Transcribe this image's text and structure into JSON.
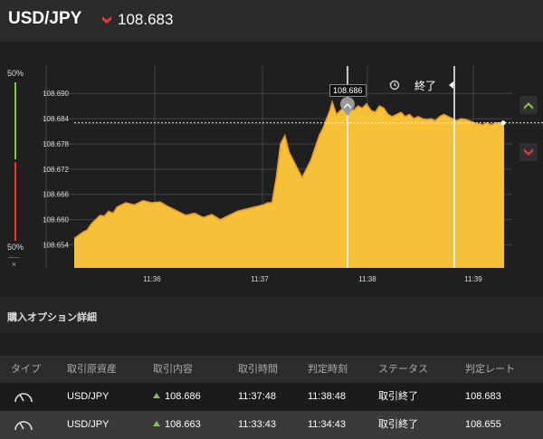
{
  "header": {
    "pair": "USD/JPY",
    "rate": "108.683",
    "direction_icon": "down-chevron-icon",
    "direction_color": "#e53935"
  },
  "chart": {
    "left_gauge": {
      "top_pct": "50%",
      "bottom_pct": "50%",
      "up_color": "#8bc34a",
      "down_color": "#e53935",
      "close_label": "×"
    },
    "tooltip_rate": "108.686",
    "end_label": "終了",
    "buttons": {
      "up_icon": "up-chevron-icon",
      "down_icon": "down-chevron-icon"
    },
    "colors": {
      "area_fill": "#f7c137",
      "area_stroke": "#e5932a",
      "grid": "#444444"
    }
  },
  "chart_data": {
    "type": "area",
    "title": "",
    "xlabel": "",
    "ylabel": "",
    "x_ticks": [
      "11:36",
      "11:37",
      "11:38",
      "11:39"
    ],
    "y_ticks": [
      108.654,
      108.66,
      108.666,
      108.672,
      108.678,
      108.684,
      108.69
    ],
    "ylim": [
      108.6485,
      108.6965
    ],
    "current_rate": 108.683,
    "markers": [
      {
        "label": "purchase",
        "time": "11:37:48",
        "rate": 108.686
      },
      {
        "label": "end",
        "time": "11:38:48"
      }
    ],
    "series": [
      {
        "values": [
          [
            0.0,
            108.6555
          ],
          [
            0.02,
            108.657
          ],
          [
            0.03,
            108.6575
          ],
          [
            0.04,
            108.659
          ],
          [
            0.05,
            108.66
          ],
          [
            0.06,
            108.661
          ],
          [
            0.07,
            108.6608
          ],
          [
            0.08,
            108.662
          ],
          [
            0.09,
            108.6615
          ],
          [
            0.1,
            108.663
          ],
          [
            0.12,
            108.664
          ],
          [
            0.14,
            108.6635
          ],
          [
            0.16,
            108.6645
          ],
          [
            0.18,
            108.664
          ],
          [
            0.2,
            108.6642
          ],
          [
            0.22,
            108.663
          ],
          [
            0.24,
            108.662
          ],
          [
            0.26,
            108.661
          ],
          [
            0.28,
            108.6615
          ],
          [
            0.3,
            108.6605
          ],
          [
            0.32,
            108.6612
          ],
          [
            0.34,
            108.66
          ],
          [
            0.36,
            108.661
          ],
          [
            0.38,
            108.662
          ],
          [
            0.4,
            108.6625
          ],
          [
            0.42,
            108.663
          ],
          [
            0.44,
            108.6635
          ],
          [
            0.45,
            108.664
          ],
          [
            0.46,
            108.664
          ],
          [
            0.47,
            108.67
          ],
          [
            0.48,
            108.678
          ],
          [
            0.49,
            108.68
          ],
          [
            0.5,
            108.676
          ],
          [
            0.51,
            108.674
          ],
          [
            0.52,
            108.672
          ],
          [
            0.53,
            108.67
          ],
          [
            0.54,
            108.672
          ],
          [
            0.55,
            108.674
          ],
          [
            0.56,
            108.677
          ],
          [
            0.57,
            108.68
          ],
          [
            0.58,
            108.682
          ],
          [
            0.585,
            108.6835
          ],
          [
            0.595,
            108.686
          ],
          [
            0.6,
            108.688
          ],
          [
            0.61,
            108.685
          ],
          [
            0.62,
            108.686
          ],
          [
            0.63,
            108.687
          ],
          [
            0.64,
            108.6865
          ],
          [
            0.65,
            108.686
          ],
          [
            0.66,
            108.687
          ],
          [
            0.67,
            108.6865
          ],
          [
            0.68,
            108.6875
          ],
          [
            0.69,
            108.686
          ],
          [
            0.7,
            108.6855
          ],
          [
            0.71,
            108.687
          ],
          [
            0.72,
            108.6865
          ],
          [
            0.73,
            108.685
          ],
          [
            0.74,
            108.6845
          ],
          [
            0.75,
            108.685
          ],
          [
            0.76,
            108.6855
          ],
          [
            0.77,
            108.6845
          ],
          [
            0.78,
            108.685
          ],
          [
            0.79,
            108.684
          ],
          [
            0.8,
            108.6845
          ],
          [
            0.81,
            108.684
          ],
          [
            0.82,
            108.6838
          ],
          [
            0.83,
            108.684
          ],
          [
            0.84,
            108.6835
          ],
          [
            0.85,
            108.6845
          ],
          [
            0.86,
            108.685
          ],
          [
            0.87,
            108.6845
          ],
          [
            0.88,
            108.684
          ],
          [
            0.89,
            108.6835
          ],
          [
            0.9,
            108.684
          ],
          [
            0.91,
            108.6838
          ],
          [
            0.92,
            108.6835
          ],
          [
            0.93,
            108.683
          ],
          [
            0.94,
            108.6828
          ],
          [
            0.95,
            108.6825
          ],
          [
            0.96,
            108.683
          ],
          [
            0.97,
            108.6825
          ],
          [
            0.98,
            108.683
          ],
          [
            1.0,
            108.683
          ]
        ]
      }
    ]
  },
  "details": {
    "section_title": "購入オプション詳細",
    "columns": [
      "タイプ",
      "取引原資産",
      "取引内容",
      "取引時間",
      "判定時刻",
      "ステータス",
      "判定レート"
    ],
    "rows": [
      {
        "type_icon": "gauge-icon",
        "asset": "USD/JPY",
        "direction_icon": "up-arrow-icon",
        "content": "108.686",
        "trade_time": "11:37:48",
        "judge_time": "11:38:48",
        "status": "取引終了",
        "judge_rate": "108.683"
      },
      {
        "type_icon": "gauge-icon",
        "asset": "USD/JPY",
        "direction_icon": "up-arrow-icon",
        "content": "108.663",
        "trade_time": "11:33:43",
        "judge_time": "11:34:43",
        "status": "取引終了",
        "judge_rate": "108.655"
      }
    ]
  }
}
